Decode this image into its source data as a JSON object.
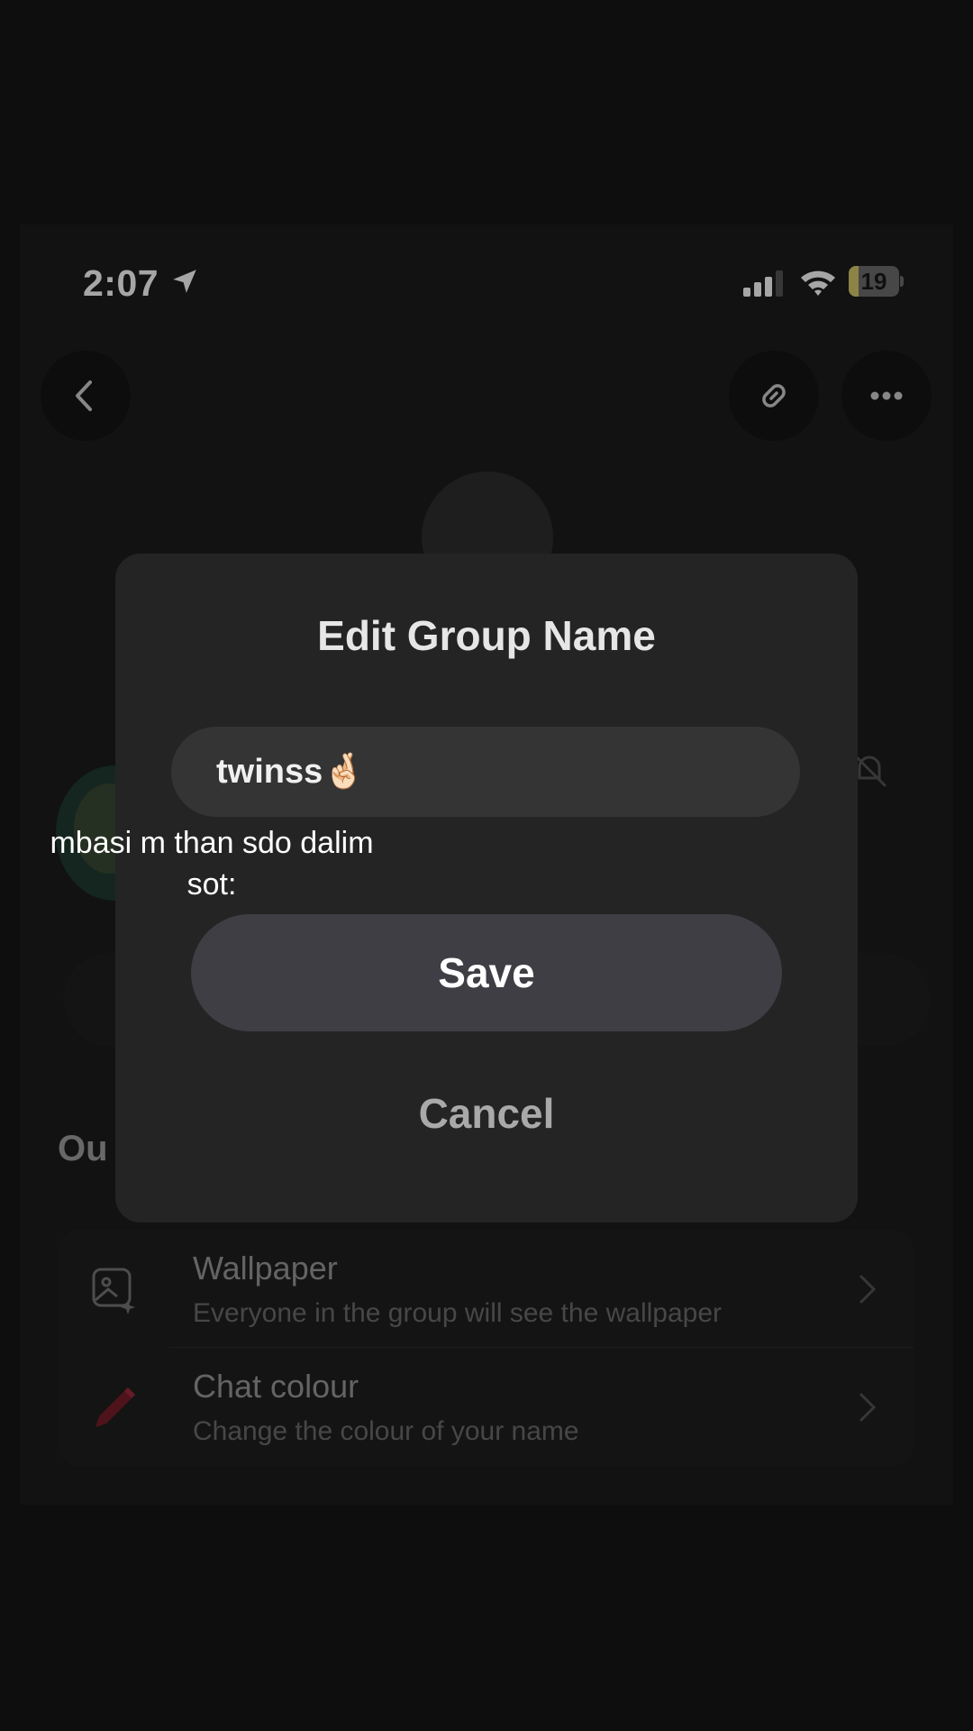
{
  "status_bar": {
    "time": "2:07",
    "battery_level": "19",
    "battery_fraction": 0.19,
    "battery_color": "#d8c96a"
  },
  "header": {
    "back_icon": "chevron-left-icon",
    "link_icon": "link-icon",
    "more_icon": "ellipsis-icon"
  },
  "dialog": {
    "title": "Edit Group Name",
    "input_value": "twinss🤞🏻",
    "save_label": "Save",
    "cancel_label": "Cancel"
  },
  "background": {
    "section_title": "Ou",
    "settings": [
      {
        "title": "Wallpaper",
        "subtitle": "Everyone in the group will see the wallpaper",
        "icon": "wallpaper-icon"
      },
      {
        "title": "Chat colour",
        "subtitle": "Change the colour of your name",
        "icon": "crayon-icon"
      }
    ]
  },
  "overlay_caption": {
    "line1": "mbasi m than sdo dalim",
    "line2": "sot:"
  }
}
